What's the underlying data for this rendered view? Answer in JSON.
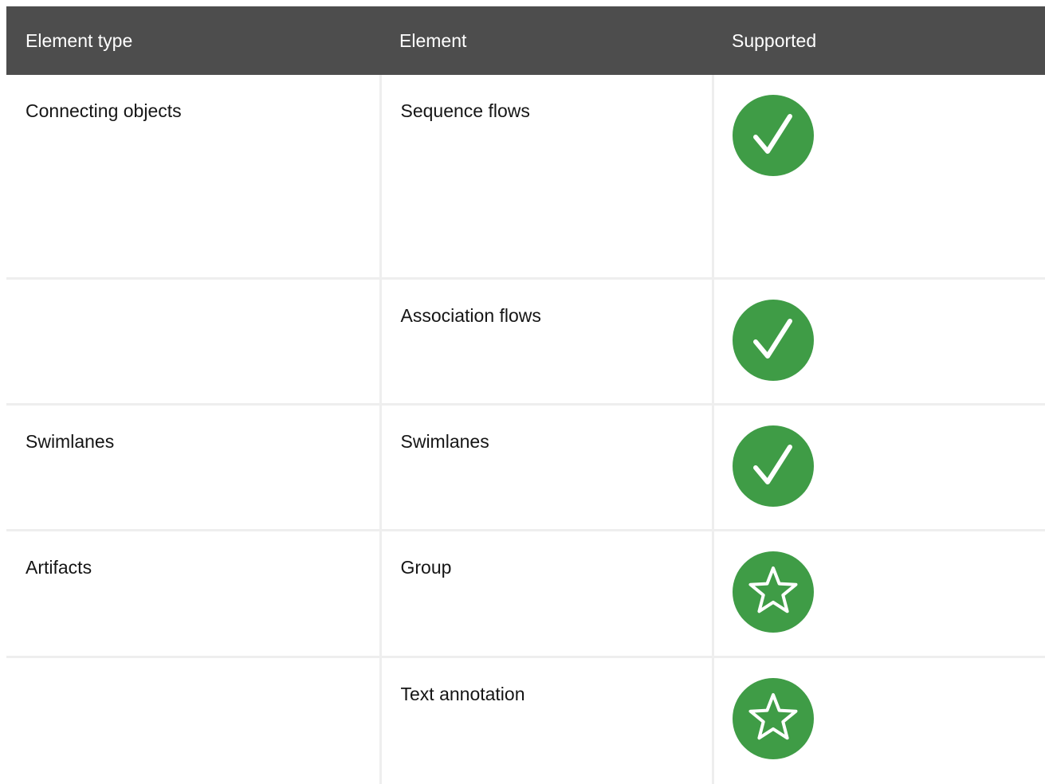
{
  "table": {
    "headers": [
      "Element type",
      "Element",
      "Supported"
    ],
    "rows": [
      {
        "type": "Connecting objects",
        "element": "Sequence flows",
        "supported_icon": "check-circle-icon"
      },
      {
        "type": "",
        "element": "Association flows",
        "supported_icon": "check-circle-icon"
      },
      {
        "type": "Swimlanes",
        "element": "Swimlanes",
        "supported_icon": "check-circle-icon"
      },
      {
        "type": "Artifacts",
        "element": "Group",
        "supported_icon": "star-circle-icon"
      },
      {
        "type": "",
        "element": "Text annotation",
        "supported_icon": "star-circle-icon"
      }
    ]
  },
  "colors": {
    "header_bg": "#4d4d4d",
    "header_text": "#ffffff",
    "badge_green": "#3f9c46",
    "grid_line": "#eeeeee"
  }
}
